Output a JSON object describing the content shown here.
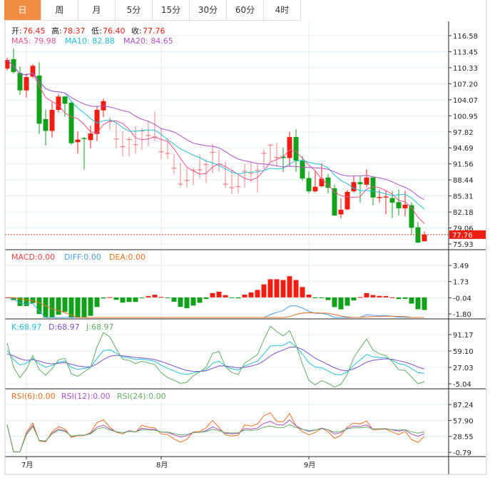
{
  "tabs": [
    {
      "label": "日",
      "active": true
    },
    {
      "label": "周"
    },
    {
      "label": "月"
    },
    {
      "label": "5分"
    },
    {
      "label": "15分"
    },
    {
      "label": "30分"
    },
    {
      "label": "60分"
    },
    {
      "label": "4时"
    }
  ],
  "ohlc_legend": {
    "open_label": "开:",
    "open": "76.45",
    "high_label": "高:",
    "high": "78.37",
    "low_label": "低:",
    "low": "76.40",
    "close_label": "收:",
    "close": "77.76"
  },
  "ma_legend": {
    "ma5": "MA5: 79.98",
    "ma10": "MA10: 82.88",
    "ma20": "MA20: 84.65"
  },
  "macd_legend": {
    "macd": "MACD:0.00",
    "diff": "DIFF:0.00",
    "dea": "DEA:0.00"
  },
  "kdj_legend": {
    "k": "K:68.97",
    "d": "D:68.97",
    "j": "J:68.97"
  },
  "rsi_legend": {
    "rsi6": "RSI(6):0.00",
    "rsi12": "RSI(12):0.00",
    "rsi24": "RSI(24):0.00"
  },
  "last_price": "77.76",
  "colors": {
    "up": "#f01e12",
    "down": "#11a11b",
    "ma5": "#f0508a",
    "ma10": "#22c0dd",
    "ma20": "#b050c8",
    "diff": "#4aa0f0",
    "dea": "#f07020",
    "k": "#22c0dd",
    "d": "#8050c8",
    "j": "#60b060",
    "rsi6": "#f07020",
    "rsi12": "#b050c8",
    "rsi24": "#60b060",
    "active_tab": "#f08c43"
  },
  "chart_data": {
    "type": "candlestick",
    "price_axis_ticks": [
      "116.58",
      "113.45",
      "110.33",
      "107.20",
      "104.07",
      "100.95",
      "97.82",
      "94.69",
      "91.56",
      "88.44",
      "85.31",
      "82.18",
      "79.06",
      "75.93"
    ],
    "price_range": [
      75.93,
      116.58
    ],
    "macd_axis_ticks": [
      "3.49",
      "1.73",
      "-0.04",
      "-1.80"
    ],
    "kdj_axis_ticks": [
      "91.17",
      "59.10",
      "27.03",
      "-5.04"
    ],
    "rsi_axis_ticks": [
      "87.24",
      "57.90",
      "28.55",
      "-0.79"
    ],
    "x_labels": [
      {
        "label": "7月",
        "index": 3
      },
      {
        "label": "8月",
        "index": 24
      },
      {
        "label": "9月",
        "index": 47
      }
    ],
    "candles_ohlc": [
      [
        110.17,
        112.3,
        109.8,
        111.85
      ],
      [
        112.0,
        114.1,
        109.2,
        109.5
      ],
      [
        109.3,
        110.6,
        105.0,
        105.9
      ],
      [
        105.9,
        109.2,
        104.5,
        108.5
      ],
      [
        108.6,
        111.0,
        108.3,
        110.7
      ],
      [
        108.8,
        111.4,
        97.4,
        99.4
      ],
      [
        100.3,
        102.1,
        95.1,
        98.0
      ],
      [
        98.0,
        103.6,
        96.7,
        102.1
      ],
      [
        102.1,
        105.2,
        101.6,
        104.7
      ],
      [
        104.7,
        104.8,
        100.8,
        103.3
      ],
      [
        103.5,
        103.7,
        95.3,
        95.6
      ],
      [
        95.8,
        97.9,
        93.6,
        96.3
      ],
      [
        96.6,
        96.8,
        90.5,
        96.4
      ],
      [
        96.2,
        99.0,
        94.6,
        97.5
      ],
      [
        97.4,
        102.8,
        96.0,
        102.1
      ],
      [
        102.0,
        104.3,
        100.7,
        103.8
      ],
      [
        99.8,
        100.7,
        98.2,
        99.9
      ],
      [
        96.4,
        99.6,
        94.6,
        96.5
      ],
      [
        94.9,
        97.9,
        93.0,
        95.0
      ],
      [
        96.3,
        96.8,
        93.0,
        96.4
      ],
      [
        95.3,
        98.9,
        93.6,
        95.4
      ],
      [
        98.0,
        98.5,
        94.3,
        98.1
      ],
      [
        97.1,
        100.0,
        95.0,
        97.2
      ],
      [
        96.8,
        101.8,
        96.0,
        96.9
      ],
      [
        93.9,
        98.6,
        92.5,
        94.0
      ],
      [
        93.6,
        96.5,
        92.5,
        93.7
      ],
      [
        90.7,
        93.5,
        89.5,
        90.8
      ],
      [
        87.6,
        91.8,
        87.0,
        87.7
      ],
      [
        88.3,
        90.8,
        87.0,
        88.4
      ],
      [
        90.3,
        90.8,
        87.4,
        90.4
      ],
      [
        90.4,
        93.4,
        88.7,
        90.5
      ],
      [
        91.4,
        92.5,
        87.8,
        91.5
      ],
      [
        93.8,
        95.4,
        89.7,
        93.9
      ],
      [
        91.5,
        94.4,
        90.0,
        91.6
      ],
      [
        87.6,
        92.0,
        86.9,
        87.7
      ],
      [
        86.9,
        90.4,
        85.6,
        87.0
      ],
      [
        87.1,
        89.3,
        85.8,
        87.2
      ],
      [
        90.1,
        91.5,
        86.9,
        90.2
      ],
      [
        89.7,
        92.0,
        88.0,
        89.8
      ],
      [
        90.3,
        91.5,
        86.0,
        90.4
      ],
      [
        93.6,
        94.4,
        90.6,
        93.7
      ],
      [
        95.2,
        95.4,
        92.0,
        95.3
      ],
      [
        92.8,
        95.7,
        91.0,
        92.9
      ],
      [
        93.0,
        94.7,
        90.0,
        92.7
      ],
      [
        92.7,
        97.8,
        91.0,
        96.8
      ],
      [
        96.8,
        98.3,
        90.0,
        92.2
      ],
      [
        92.2,
        93.1,
        88.3,
        88.7
      ],
      [
        88.8,
        90.1,
        85.8,
        86.2
      ],
      [
        86.2,
        90.1,
        86.0,
        87.1
      ],
      [
        87.2,
        91.7,
        87.0,
        88.7
      ],
      [
        88.9,
        89.6,
        85.8,
        86.9
      ],
      [
        86.8,
        87.5,
        81.4,
        81.5
      ],
      [
        81.7,
        84.8,
        80.9,
        82.6
      ],
      [
        82.7,
        86.5,
        82.5,
        86.1
      ],
      [
        86.2,
        89.1,
        86.0,
        88.0
      ],
      [
        88.0,
        89.2,
        84.0,
        87.6
      ],
      [
        87.5,
        90.5,
        87.0,
        88.9
      ],
      [
        88.9,
        89.1,
        83.5,
        85.0
      ],
      [
        84.9,
        86.5,
        84.0,
        85.1
      ],
      [
        85.0,
        86.3,
        81.7,
        85.2
      ],
      [
        84.9,
        86.3,
        81.0,
        84.0
      ],
      [
        84.1,
        86.6,
        81.5,
        82.9
      ],
      [
        82.9,
        86.3,
        81.4,
        83.6
      ],
      [
        83.5,
        84.0,
        77.7,
        79.1
      ],
      [
        79.2,
        80.2,
        76.1,
        76.2
      ],
      [
        76.45,
        78.37,
        76.4,
        77.76
      ]
    ]
  }
}
